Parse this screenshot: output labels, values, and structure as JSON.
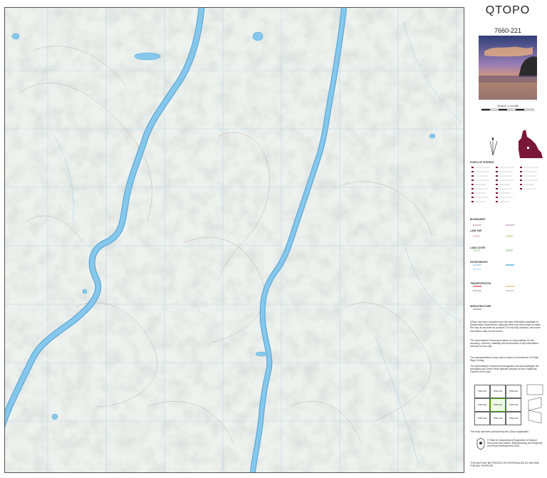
{
  "title": "QTOPO",
  "sheet_number": "7660-221",
  "scale_text": "SCALE 1:10,000",
  "legend": {
    "heading": "POINTS OF INTEREST",
    "boundaries_heading": "BOUNDARIES",
    "land_use_heading": "LAND USE",
    "land_cover_heading": "LAND COVER",
    "hydrography_heading": "HYDROGRAPHY",
    "transportation_heading": "TRANSPORTATION",
    "infrastructure_heading": "INFRASTRUCTURE"
  },
  "index_map": {
    "cells": [
      "7660-212",
      "7660-213",
      "7660-214",
      "7660-222",
      "7660-221",
      "7660-224",
      "7660-231",
      "7660-232",
      "7660-233"
    ]
  },
  "notes": {
    "p1": "QTopo has been compiled from the best information available to Queensland Government. Although effort has been made to make the map as accurate as possible, it is not fully checked, and some information may not be correct.",
    "p2": "The Queensland Government takes no responsibility for the accuracy, currency, reliability and correctness of any information included on the map.",
    "p3": "The representation of any road or track is not evidence of Public Right of Way.",
    "p4": "The Queensland Government recognises and acknowledges the Aboriginal and Torres Strait Islander peoples as the Traditional Owners of the land.",
    "p5": "This map has been produced by the QTopo application.",
    "p6": "© State of Queensland (Department of Natural Resources and Mines, Manufacturing and Regional and Rural Development) 2024.",
    "p7": "THIS MAP MAY BE PRINTED OR REPRODUCED BY ANYONE FOR ANY PURPOSE"
  },
  "colors": {
    "water": "#86c8ec",
    "water_edge": "#5ea9d6",
    "terrain": "#eef2ef",
    "contour": "#b89b8a",
    "grid": "#b8d6e8",
    "maroon": "#7a1736"
  }
}
